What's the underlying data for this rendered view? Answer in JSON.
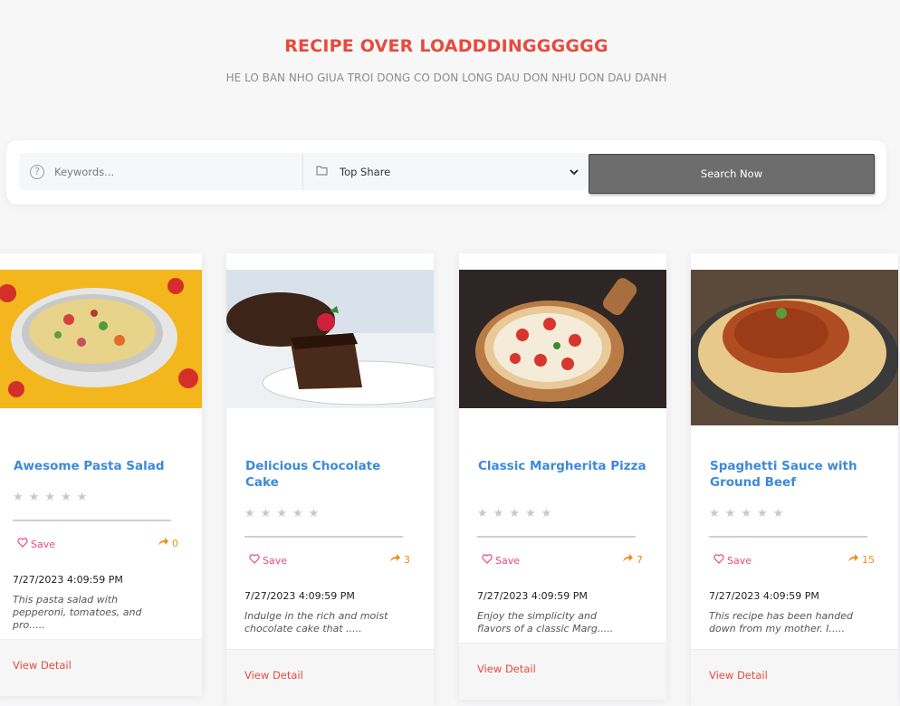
{
  "header": {
    "title": "RECIPE OVER LOADDDINGGGGGG",
    "subtitle": "HE LO BAN NHO GIUA TROI DONG CO DON LONG DAU DON NHU DON DAU DANH"
  },
  "search": {
    "keyword_placeholder": "Keywords...",
    "keyword_value": "",
    "filter_selected": "Top Share",
    "button_label": "Search Now"
  },
  "cards": [
    {
      "title": "Awesome Pasta Salad",
      "save_label": "Save",
      "share_count": "0",
      "date": "7/27/2023 4:09:59 PM",
      "description": "This pasta salad with pepperoni, tomatoes, and pro.....",
      "link": "View Detail",
      "image": "pasta-salad-photo"
    },
    {
      "title": "Delicious Chocolate Cake",
      "save_label": "Save",
      "share_count": "3",
      "date": "7/27/2023 4:09:59 PM",
      "description": "Indulge in the rich and moist chocolate cake that .....",
      "link": "View Detail",
      "image": "chocolate-cake-photo"
    },
    {
      "title": "Classic Margherita Pizza",
      "save_label": "Save",
      "share_count": "7",
      "date": "7/27/2023 4:09:59 PM",
      "description": "Enjoy the simplicity and flavors of a classic Marg.....",
      "link": "View Detail",
      "image": "margherita-pizza-photo"
    },
    {
      "title": "Spaghetti Sauce with Ground Beef",
      "save_label": "Save",
      "share_count": "15",
      "date": "7/27/2023 4:09:59 PM",
      "description": "This recipe has been handed down from my mother. I.....",
      "link": "View Detail",
      "image": "spaghetti-photo"
    }
  ],
  "rating": {
    "stars": 5,
    "filled": 0
  },
  "colors": {
    "accent": "#e84a3c",
    "title_blue": "#3c8ad8",
    "save_pink": "#e74a7d",
    "share_orange": "#f08a1a"
  }
}
